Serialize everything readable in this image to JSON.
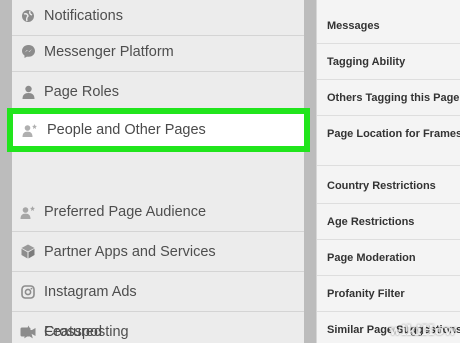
{
  "left_menu": {
    "items": [
      {
        "label": "Notifications",
        "icon": "globe-icon"
      },
      {
        "label": "Messenger Platform",
        "icon": "messenger-icon"
      },
      {
        "label": "Page Roles",
        "icon": "person-icon"
      },
      {
        "label": "People and Other Pages",
        "icon": "person-star-icon",
        "active": true
      },
      {
        "label": "Preferred Page Audience",
        "icon": "person-star-icon"
      },
      {
        "label": "Partner Apps and Services",
        "icon": "cube-icon"
      },
      {
        "label": "Instagram Ads",
        "icon": "instagram-icon"
      },
      {
        "label": "Featured",
        "icon": "star-icon"
      },
      {
        "label": "Crossposting",
        "icon": "video-camera-icon"
      }
    ]
  },
  "right_settings": {
    "items": [
      "Messages",
      "Tagging Ability",
      "Others Tagging this Page",
      "Page Location for Frames",
      "Country Restrictions",
      "Age Restrictions",
      "Page Moderation",
      "Profanity Filter",
      "Similar Page Suggestions"
    ]
  },
  "watermark": "wikiHow",
  "colors": {
    "highlight": "#21e51c",
    "menu_bg": "#ececec",
    "text": "#4e4e4e"
  }
}
